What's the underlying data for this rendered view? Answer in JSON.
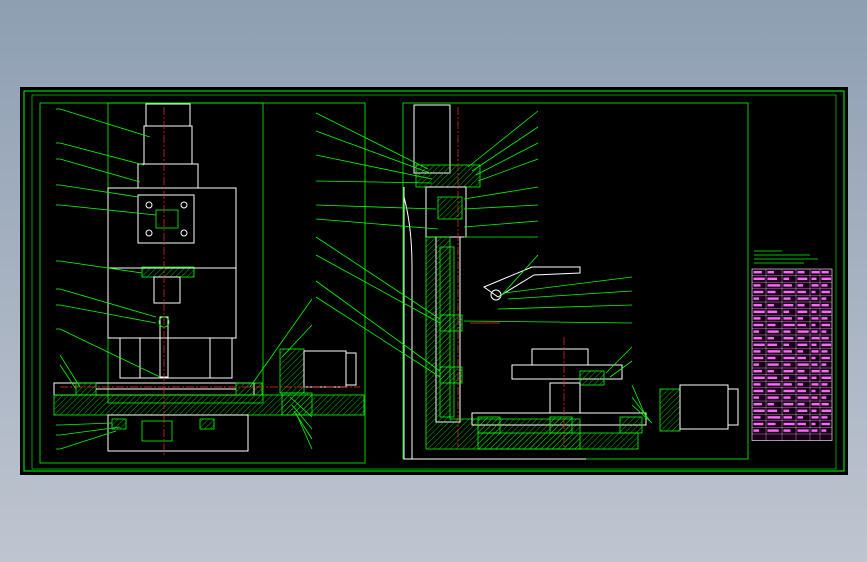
{
  "sheet": {
    "background": "#000000",
    "line_color": "#ffffff",
    "accent_color": "#00ff00",
    "center_line_color": "#ff2a2a",
    "table_color": "#ff66ff"
  },
  "views": [
    {
      "name": "front-elevation"
    },
    {
      "name": "side-elevation"
    }
  ],
  "title_block": {
    "rows": 26,
    "columns": 6
  }
}
